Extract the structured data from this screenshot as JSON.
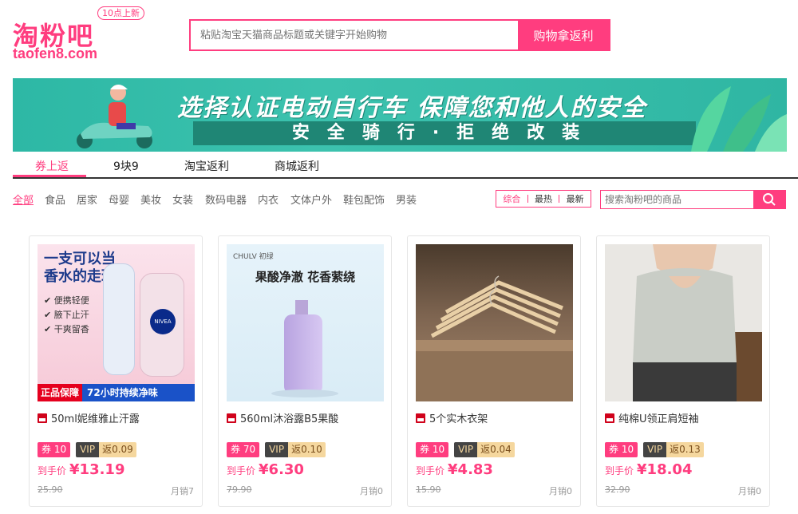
{
  "logo": {
    "cn": "淘粉吧",
    "en": "taofen8.com",
    "badge": "10点上新"
  },
  "search_top": {
    "placeholder": "粘贴淘宝天猫商品标题或关键字开始购物",
    "button": "购物拿返利"
  },
  "banner": {
    "title": "选择认证电动自行车  保障您和他人的安全",
    "subtitle": "安全骑行·拒绝改装"
  },
  "nav": {
    "items": [
      "券上返",
      "9块9",
      "淘宝返利",
      "商城返利"
    ]
  },
  "categories": [
    "全部",
    "食品",
    "居家",
    "母婴",
    "美妆",
    "女装",
    "数码电器",
    "内衣",
    "文体户外",
    "鞋包配饰",
    "男装"
  ],
  "sort": [
    "综合",
    "最热",
    "最新"
  ],
  "search_inline": {
    "placeholder": "搜索淘粉吧的商品"
  },
  "colors": {
    "accent": "#ff3d7f",
    "banner": "#2db8a5"
  },
  "products": [
    {
      "title": "50ml妮维雅止汗露",
      "coupon": "券 10",
      "vip": "VIP",
      "rebate": "返0.09",
      "price_label": "到手价",
      "price": "¥13.19",
      "original": "25.90",
      "sales": "月销7",
      "img": {
        "headline1": "一支可以当",
        "headline2": "香水的走珠露",
        "f1": "便携轻便",
        "f2": "腋下止汗",
        "f3": "干爽留香",
        "strip_a": "正品保障",
        "strip_b": "72小时持续净味",
        "brand": "NIVEA"
      }
    },
    {
      "title": "560ml沐浴露B5果酸",
      "coupon": "券 70",
      "vip": "VIP",
      "rebate": "返0.10",
      "price_label": "到手价",
      "price": "¥6.30",
      "original": "79.90",
      "sales": "月销0",
      "img": {
        "brand": "CHULV 初绿",
        "headline": "果酸净澈 花香萦绕"
      }
    },
    {
      "title": "5个实木衣架",
      "coupon": "券 10",
      "vip": "VIP",
      "rebate": "返0.04",
      "price_label": "到手价",
      "price": "¥4.83",
      "original": "15.90",
      "sales": "月销0"
    },
    {
      "title": "纯棉U领正肩短袖",
      "coupon": "券 10",
      "vip": "VIP",
      "rebate": "返0.13",
      "price_label": "到手价",
      "price": "¥18.04",
      "original": "32.90",
      "sales": "月销0"
    }
  ]
}
